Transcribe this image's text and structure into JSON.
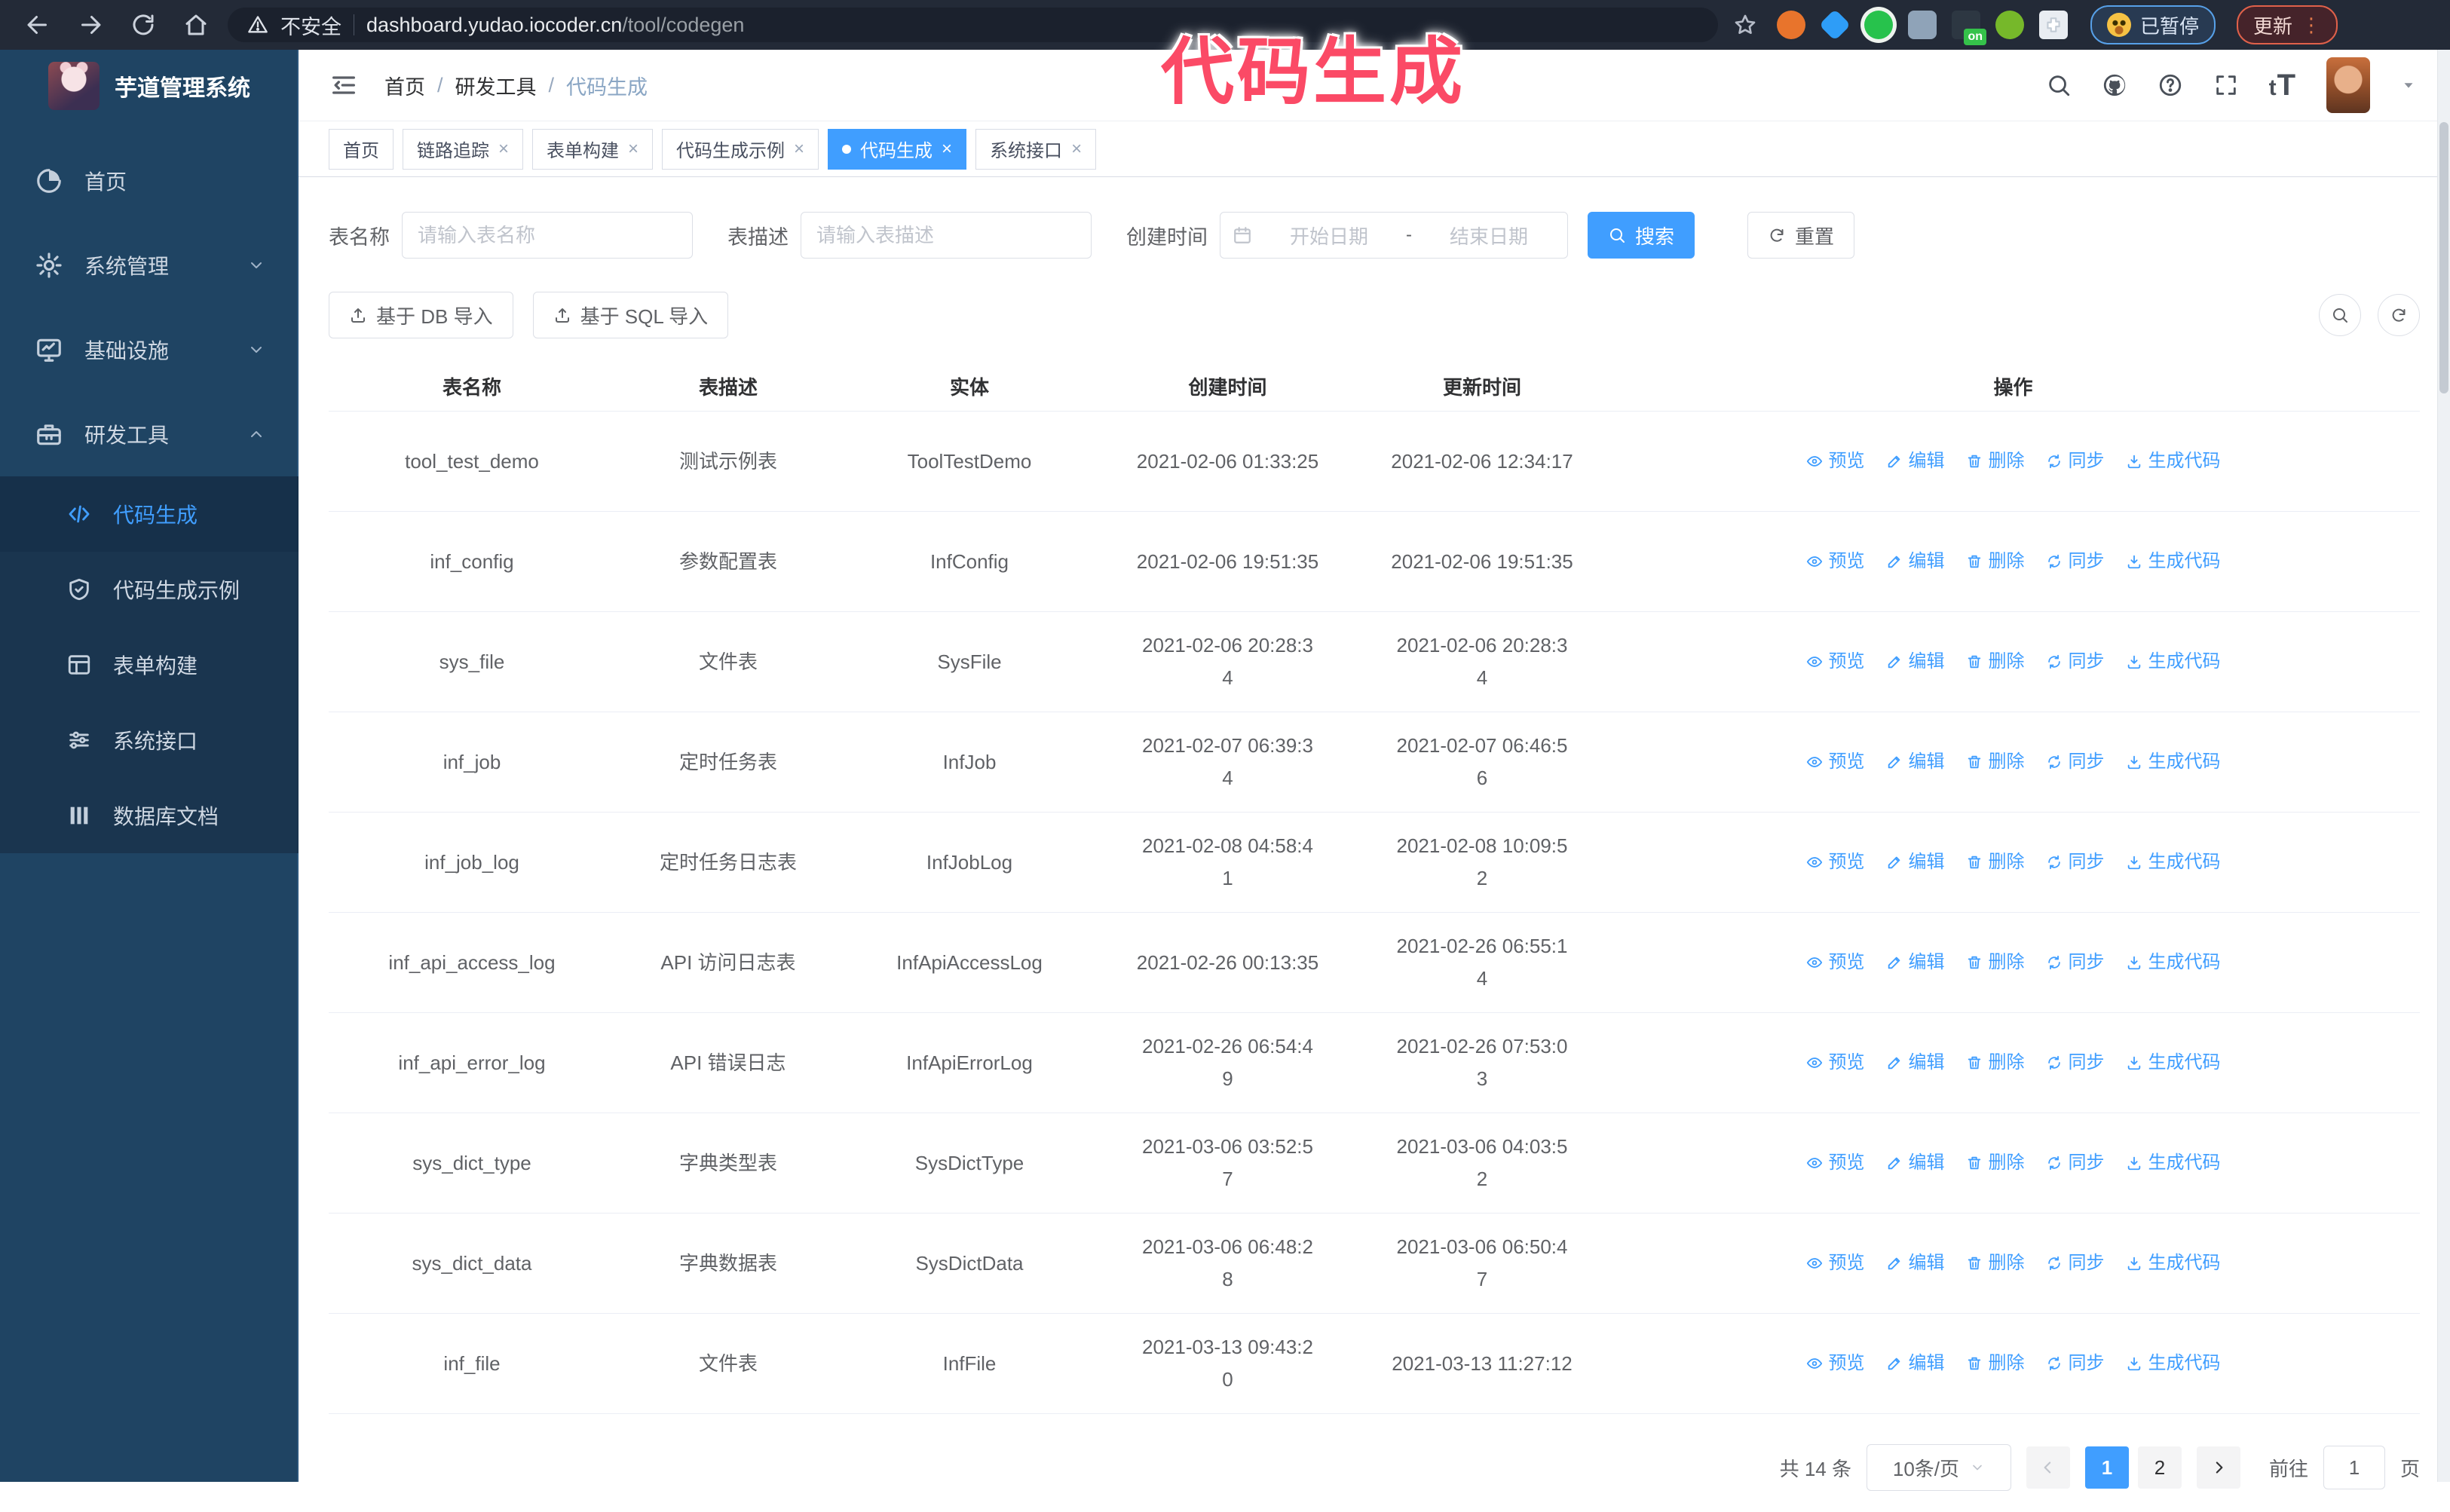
{
  "colors": {
    "accent": "#409eff",
    "annotation_pink": "#fb4a66",
    "sidebar_bg": "#1f4463",
    "submenu_bg": "#1a354f"
  },
  "annotation": {
    "text": "代码生成"
  },
  "browser": {
    "security_label": "不安全",
    "url_host": "dashboard.yudao.iocoder.cn",
    "url_path": "/tool/codegen",
    "extension_badge": "on",
    "paused_button": "已暂停",
    "update_button": "更新"
  },
  "sidebar": {
    "app_title": "芋道管理系统",
    "items": [
      {
        "name": "home",
        "label": "首页",
        "icon": "pie-chart-icon"
      },
      {
        "name": "system-management",
        "label": "系统管理",
        "icon": "gear-icon",
        "chevron": "chevron-down-icon"
      },
      {
        "name": "infrastructure",
        "label": "基础设施",
        "icon": "monitor-icon",
        "chevron": "chevron-down-icon"
      },
      {
        "name": "dev-tools",
        "label": "研发工具",
        "icon": "toolbox-icon",
        "chevron": "chevron-up-icon"
      }
    ],
    "sub_items": [
      {
        "name": "code-generation",
        "label": "代码生成",
        "icon": "code-icon",
        "active": true
      },
      {
        "name": "code-generation-example",
        "label": "代码生成示例",
        "icon": "shield-check-icon",
        "active": false
      },
      {
        "name": "form-builder",
        "label": "表单构建",
        "icon": "form-icon",
        "active": false
      },
      {
        "name": "system-api",
        "label": "系统接口",
        "icon": "sliders-icon",
        "active": false
      },
      {
        "name": "database-doc",
        "label": "数据库文档",
        "icon": "database-icon",
        "active": false
      }
    ]
  },
  "header": {
    "breadcrumb": [
      "首页",
      "研发工具",
      "代码生成"
    ]
  },
  "tabs": [
    {
      "label": "首页",
      "closable": false,
      "active": false
    },
    {
      "label": "链路追踪",
      "closable": true,
      "active": false
    },
    {
      "label": "表单构建",
      "closable": true,
      "active": false
    },
    {
      "label": "代码生成示例",
      "closable": true,
      "active": false
    },
    {
      "label": "代码生成",
      "closable": true,
      "active": true
    },
    {
      "label": "系统接口",
      "closable": true,
      "active": false
    }
  ],
  "filters": {
    "table_name": {
      "label": "表名称",
      "placeholder": "请输入表名称"
    },
    "table_desc": {
      "label": "表描述",
      "placeholder": "请输入表描述"
    },
    "create_time": {
      "label": "创建时间",
      "start_placeholder": "开始日期",
      "separator": "-",
      "end_placeholder": "结束日期"
    },
    "search_label": "搜索",
    "reset_label": "重置"
  },
  "toolbar": {
    "db_import_label": "基于 DB 导入",
    "sql_import_label": "基于 SQL 导入"
  },
  "table": {
    "columns": [
      "表名称",
      "表描述",
      "实体",
      "创建时间",
      "更新时间",
      "操作"
    ],
    "actions": [
      {
        "name": "preview",
        "label": "预览",
        "icon": "eye-icon"
      },
      {
        "name": "edit",
        "label": "编辑",
        "icon": "edit-icon"
      },
      {
        "name": "delete",
        "label": "删除",
        "icon": "delete-icon"
      },
      {
        "name": "sync",
        "label": "同步",
        "icon": "sync-icon"
      },
      {
        "name": "generate-code",
        "label": "生成代码",
        "icon": "download-icon"
      }
    ],
    "rows": [
      {
        "name": "tool_test_demo",
        "desc": "测试示例表",
        "entity": "ToolTestDemo",
        "created": "2021-02-06 01:33:25",
        "updated": "2021-02-06 12:34:17"
      },
      {
        "name": "inf_config",
        "desc": "参数配置表",
        "entity": "InfConfig",
        "created": "2021-02-06 19:51:35",
        "updated": "2021-02-06 19:51:35"
      },
      {
        "name": "sys_file",
        "desc": "文件表",
        "entity": "SysFile",
        "created": "2021-02-06 20:28:3\n4",
        "updated": "2021-02-06 20:28:3\n4"
      },
      {
        "name": "inf_job",
        "desc": "定时任务表",
        "entity": "InfJob",
        "created": "2021-02-07 06:39:3\n4",
        "updated": "2021-02-07 06:46:5\n6"
      },
      {
        "name": "inf_job_log",
        "desc": "定时任务日志表",
        "entity": "InfJobLog",
        "created": "2021-02-08 04:58:4\n1",
        "updated": "2021-02-08 10:09:5\n2"
      },
      {
        "name": "inf_api_access_log",
        "desc": "API 访问日志表",
        "entity": "InfApiAccessLog",
        "created": "2021-02-26 00:13:35",
        "updated": "2021-02-26 06:55:1\n4"
      },
      {
        "name": "inf_api_error_log",
        "desc": "API 错误日志",
        "entity": "InfApiErrorLog",
        "created": "2021-02-26 06:54:4\n9",
        "updated": "2021-02-26 07:53:0\n3"
      },
      {
        "name": "sys_dict_type",
        "desc": "字典类型表",
        "entity": "SysDictType",
        "created": "2021-03-06 03:52:5\n7",
        "updated": "2021-03-06 04:03:5\n2"
      },
      {
        "name": "sys_dict_data",
        "desc": "字典数据表",
        "entity": "SysDictData",
        "created": "2021-03-06 06:48:2\n8",
        "updated": "2021-03-06 06:50:4\n7"
      },
      {
        "name": "inf_file",
        "desc": "文件表",
        "entity": "InfFile",
        "created": "2021-03-13 09:43:2\n0",
        "updated": "2021-03-13 11:27:12"
      }
    ]
  },
  "pagination": {
    "total_label": "共 14 条",
    "page_size_label": "10条/页",
    "pages": [
      "1",
      "2"
    ],
    "active_page": "1",
    "goto_label": "前往",
    "goto_value": "1",
    "unit_label": "页"
  }
}
